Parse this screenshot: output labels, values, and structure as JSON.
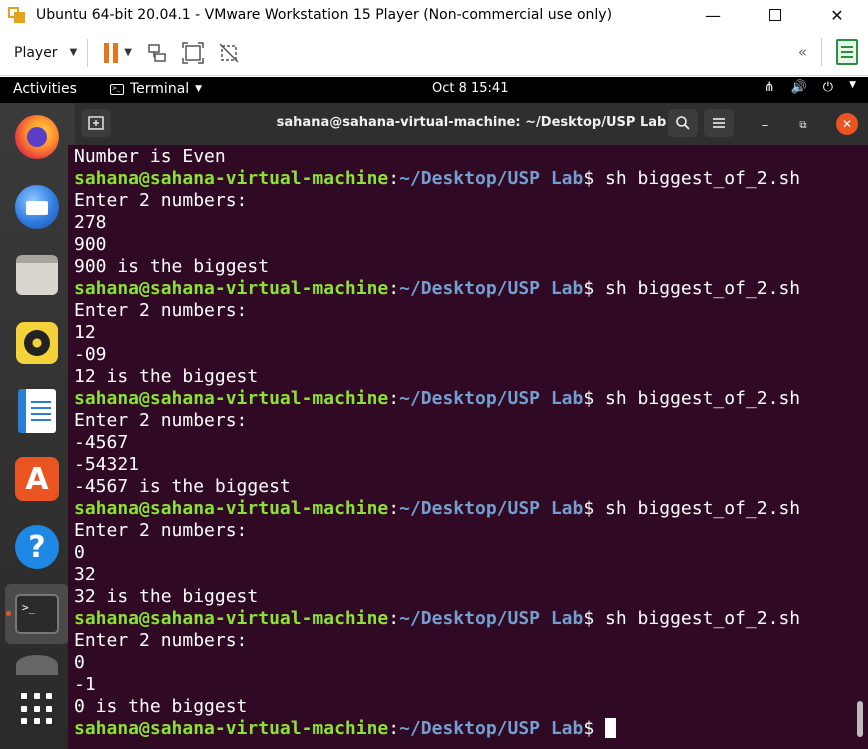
{
  "vm_window": {
    "title": "Ubuntu 64-bit 20.04.1 - VMware Workstation 15 Player (Non-commercial use only)",
    "minimize_icon": "minimize-icon",
    "maximize_icon": "maximize-icon",
    "close_icon": "close-icon"
  },
  "vm_toolbar": {
    "player_label": "Player",
    "icons": [
      "pause-icon",
      "network-icon",
      "fit-guest-icon",
      "unity-icon",
      "rewind-icon",
      "library-icon"
    ],
    "accent_color": "#e8731a"
  },
  "ubuntu_topbar": {
    "activities": "Activities",
    "app_menu": "Terminal",
    "clock": "Oct 8  15:41",
    "tray_icons": [
      "network-icon",
      "volume-icon",
      "power-icon",
      "chevron-down-icon"
    ]
  },
  "dock": {
    "items": [
      {
        "name": "firefox",
        "icon": "firefox-icon"
      },
      {
        "name": "thunderbird",
        "icon": "thunderbird-icon"
      },
      {
        "name": "files",
        "icon": "files-icon"
      },
      {
        "name": "rhythmbox",
        "icon": "rhythmbox-icon"
      },
      {
        "name": "libreoffice-writer",
        "icon": "writer-icon"
      },
      {
        "name": "ubuntu-software",
        "icon": "store-icon",
        "glyph": "A"
      },
      {
        "name": "help",
        "icon": "help-icon",
        "glyph": "?"
      },
      {
        "name": "terminal",
        "icon": "terminal-icon",
        "glyph": ">_",
        "active": true
      },
      {
        "name": "show-applications",
        "icon": "grid-icon"
      }
    ]
  },
  "terminal": {
    "title": "sahana@sahana-virtual-machine: ~/Desktop/USP Lab",
    "prompt_user": "sahana@sahana-virtual-machine",
    "prompt_sep": ":",
    "prompt_path": "~/Desktop/USP Lab",
    "prompt_end": "$ ",
    "colors": {
      "background": "#300a24",
      "user": "#8ae234",
      "path": "#729fcf",
      "text": "#ffffff"
    },
    "lines": [
      {
        "type": "out",
        "text": "Number is Even"
      },
      {
        "type": "prompt",
        "cmd": "sh biggest_of_2.sh"
      },
      {
        "type": "out",
        "text": "Enter 2 numbers:"
      },
      {
        "type": "out",
        "text": "278"
      },
      {
        "type": "out",
        "text": "900"
      },
      {
        "type": "out",
        "text": "900 is the biggest"
      },
      {
        "type": "prompt",
        "cmd": "sh biggest_of_2.sh"
      },
      {
        "type": "out",
        "text": "Enter 2 numbers:"
      },
      {
        "type": "out",
        "text": "12"
      },
      {
        "type": "out",
        "text": "-09"
      },
      {
        "type": "out",
        "text": "12 is the biggest"
      },
      {
        "type": "prompt",
        "cmd": "sh biggest_of_2.sh"
      },
      {
        "type": "out",
        "text": "Enter 2 numbers:"
      },
      {
        "type": "out",
        "text": "-4567"
      },
      {
        "type": "out",
        "text": "-54321"
      },
      {
        "type": "out",
        "text": "-4567 is the biggest"
      },
      {
        "type": "prompt",
        "cmd": "sh biggest_of_2.sh"
      },
      {
        "type": "out",
        "text": "Enter 2 numbers:"
      },
      {
        "type": "out",
        "text": "0"
      },
      {
        "type": "out",
        "text": "32"
      },
      {
        "type": "out",
        "text": "32 is the biggest"
      },
      {
        "type": "prompt",
        "cmd": "sh biggest_of_2.sh"
      },
      {
        "type": "out",
        "text": "Enter 2 numbers:"
      },
      {
        "type": "out",
        "text": "0"
      },
      {
        "type": "out",
        "text": "-1"
      },
      {
        "type": "out",
        "text": "0 is the biggest"
      },
      {
        "type": "prompt",
        "cmd": "",
        "cursor": true
      }
    ]
  }
}
